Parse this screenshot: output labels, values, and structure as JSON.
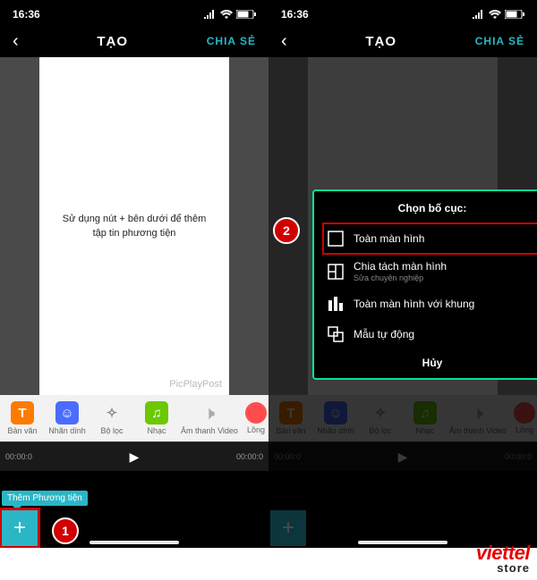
{
  "status": {
    "time": "16:36"
  },
  "nav": {
    "title": "TẠO",
    "share": "CHIA SẺ"
  },
  "canvas": {
    "placeholder": "Sử dụng nút + bên dưới để thêm tập tin phương tiện",
    "watermark": "PicPlayPost"
  },
  "tools": {
    "text": "Bản văn",
    "sticker": "Nhãn dính",
    "filter": "Bộ lọc",
    "music": "Nhạc",
    "voice": "Âm thanh Video",
    "more": "Lồng"
  },
  "timeline": {
    "start": "00:00:0",
    "end": "00:00:0"
  },
  "hint": "Thêm Phương tiện",
  "popup": {
    "title": "Chọn bố cục:",
    "opt1": "Toàn màn hình",
    "opt2": "Chia tách màn hình",
    "opt2sub": "Sửa chuyên nghiệp",
    "opt3": "Toàn màn hình với khung",
    "opt4": "Mẫu tự động",
    "cancel": "Hủy"
  },
  "steps": {
    "s1": "1",
    "s2": "2"
  },
  "brand": {
    "name": "viettel",
    "suffix": "store"
  }
}
